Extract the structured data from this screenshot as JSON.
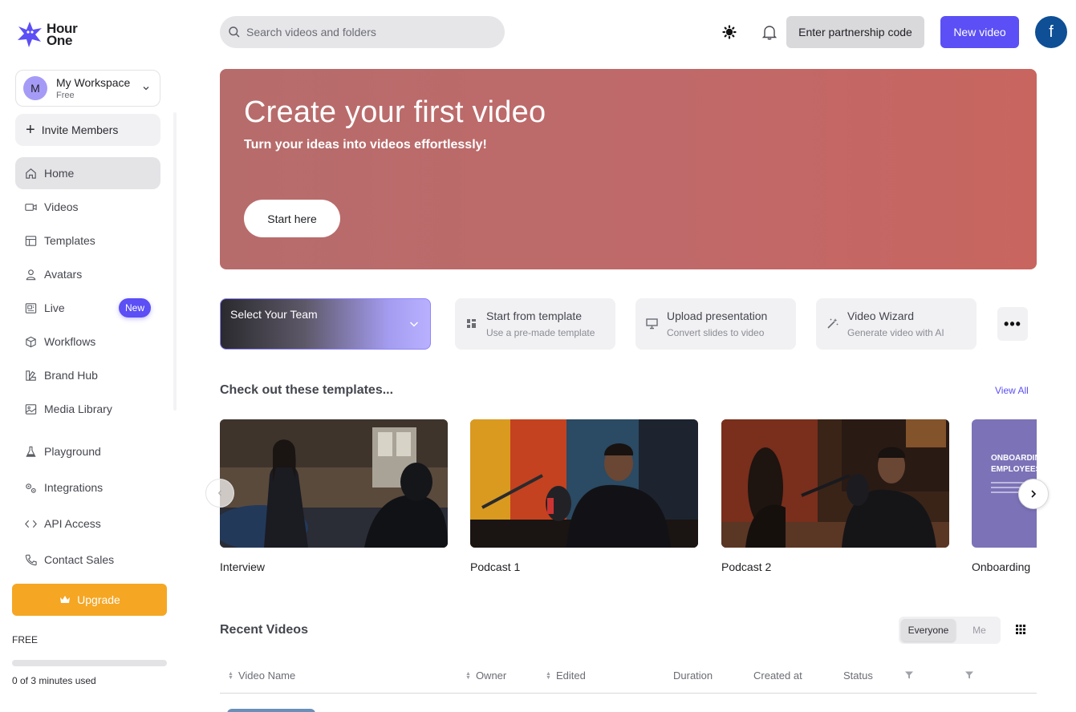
{
  "brand": {
    "name_line1": "Hour",
    "name_line2": "One",
    "logo_color": "#5b4ff5"
  },
  "workspace": {
    "initial": "M",
    "name": "My Workspace",
    "plan": "Free"
  },
  "sidebar": {
    "invite_label": "Invite Members",
    "items": [
      {
        "label": "Home",
        "icon": "home-icon",
        "active": true
      },
      {
        "label": "Videos",
        "icon": "video-camera-icon"
      },
      {
        "label": "Templates",
        "icon": "layout-icon"
      },
      {
        "label": "Avatars",
        "icon": "user-icon"
      },
      {
        "label": "Live",
        "icon": "live-icon",
        "badge": "New"
      },
      {
        "label": "Workflows",
        "icon": "cube-icon"
      },
      {
        "label": "Brand Hub",
        "icon": "brand-icon"
      },
      {
        "label": "Media Library",
        "icon": "image-icon"
      },
      {
        "label": "Playground",
        "icon": "flask-icon"
      },
      {
        "label": "Integrations",
        "icon": "gears-icon"
      },
      {
        "label": "API Access",
        "icon": "code-icon"
      },
      {
        "label": "Contact Sales",
        "icon": "phone-icon"
      }
    ],
    "upgrade_label": "Upgrade",
    "plan_label": "FREE",
    "usage_text": "0 of 3 minutes used",
    "usage_fraction": 0
  },
  "header": {
    "search_placeholder": "Search videos and folders",
    "partnership_label": "Enter partnership code",
    "new_video_label": "New video",
    "user_initial": "f"
  },
  "hero": {
    "title": "Create your first video",
    "subtitle": "Turn your ideas into videos effortlessly!",
    "button_label": "Start here"
  },
  "actions": {
    "team_select_label": "Select Your Team",
    "cards": [
      {
        "title": "Start from template",
        "desc": "Use a pre-made template",
        "icon": "template-icon"
      },
      {
        "title": "Upload presentation",
        "desc": "Convert slides to video",
        "icon": "presentation-icon"
      },
      {
        "title": "Video Wizard",
        "desc": "Generate video with AI",
        "icon": "magic-wand-icon"
      }
    ],
    "more_label": "•••"
  },
  "templates": {
    "title": "Check out these templates...",
    "view_all": "View All",
    "items": [
      {
        "label": "Interview"
      },
      {
        "label": "Podcast 1"
      },
      {
        "label": "Podcast 2"
      },
      {
        "label": "Onboarding",
        "thumb_title_1": "ONBOARDING",
        "thumb_title_2": "EMPLOYEES"
      }
    ]
  },
  "recent": {
    "title": "Recent Videos",
    "filter_everyone": "Everyone",
    "filter_me": "Me",
    "columns": [
      "Video Name",
      "Owner",
      "Edited",
      "Duration",
      "Created at",
      "Status"
    ]
  }
}
